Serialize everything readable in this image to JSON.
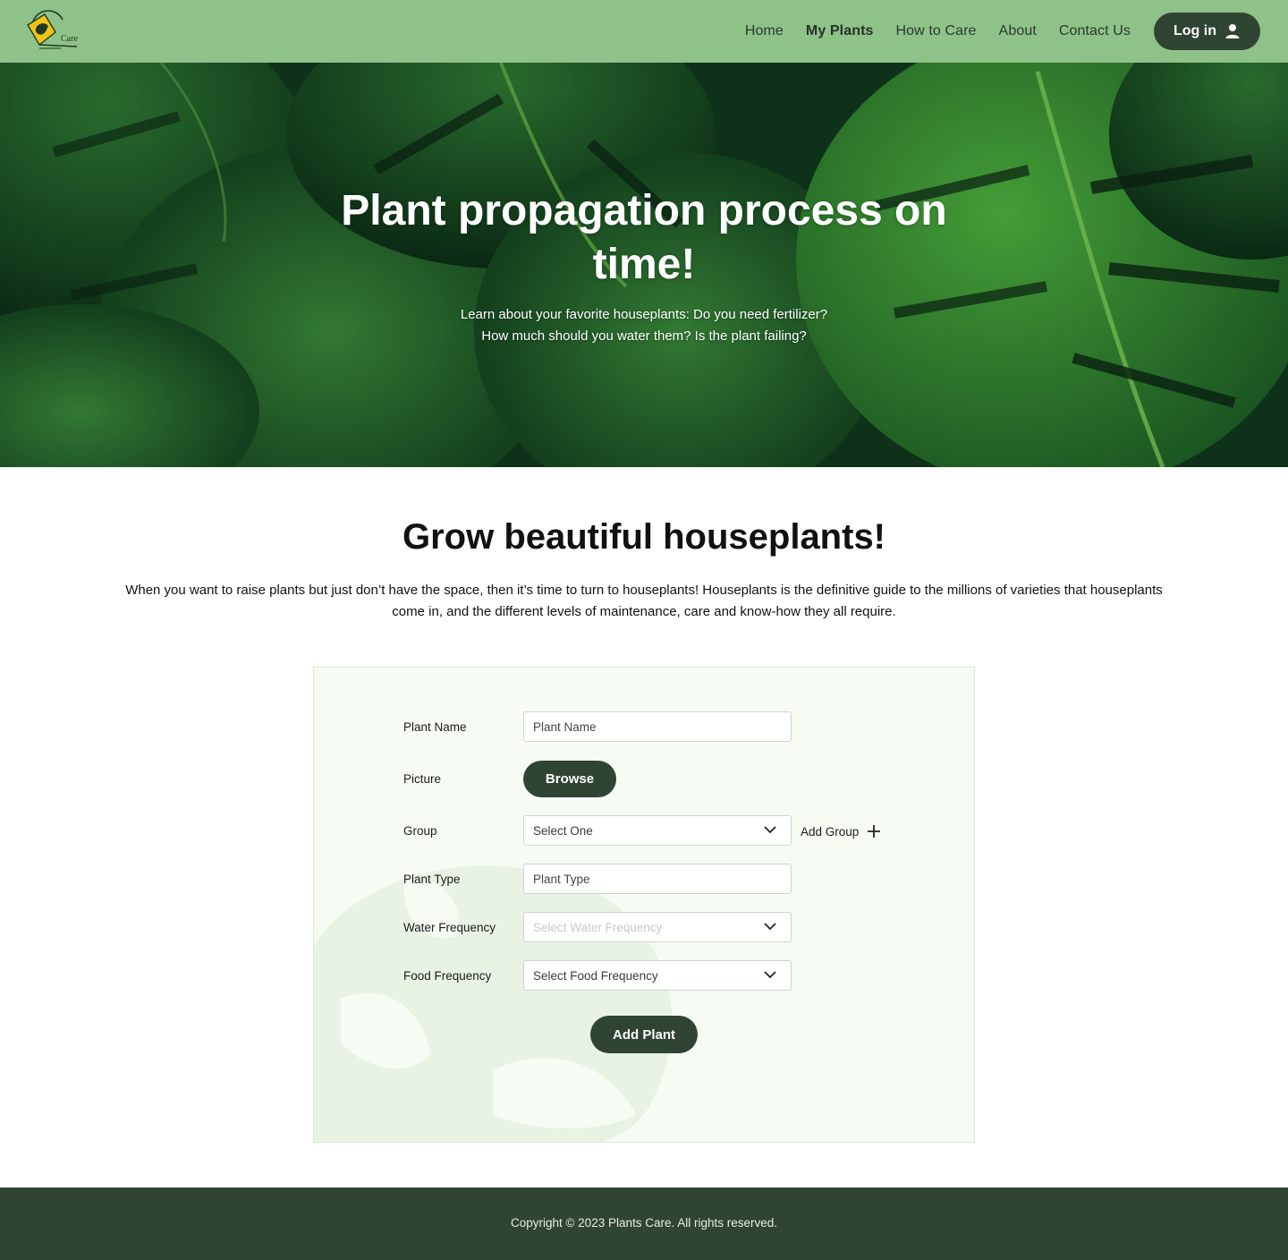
{
  "header": {
    "logo_text": "Care",
    "nav": [
      {
        "label": "Home",
        "active": false
      },
      {
        "label": "My Plants",
        "active": true
      },
      {
        "label": "How to Care",
        "active": false
      },
      {
        "label": "About",
        "active": false
      },
      {
        "label": "Contact Us",
        "active": false
      }
    ],
    "login_label": "Log in",
    "login_icon": "user-icon"
  },
  "hero": {
    "title": "Plant propagation process on time!",
    "subtitle_line1": "Learn about your favorite houseplants: Do you need fertilizer?",
    "subtitle_line2": "How much should you water them? Is the plant failing?"
  },
  "intro": {
    "title": "Grow beautiful houseplants!",
    "text": "When you want to raise plants but just don’t have the space, then it’s time to turn to houseplants! Houseplants is the definitive guide to the millions of varieties that houseplants come in, and the different levels of maintenance, care and know-how they all require."
  },
  "form": {
    "plant_name": {
      "label": "Plant Name",
      "placeholder": "Plant Name"
    },
    "picture": {
      "label": "Picture",
      "button": "Browse"
    },
    "group": {
      "label": "Group",
      "value": "Select One",
      "add_label": "Add Group"
    },
    "plant_type": {
      "label": "Plant Type",
      "placeholder": "Plant Type"
    },
    "water_frequency": {
      "label": "Water Frequency",
      "value": "Select Water Frequency"
    },
    "food_frequency": {
      "label": "Food Frequency",
      "value": "Select Food Frequency"
    },
    "submit_label": "Add Plant"
  },
  "footer": {
    "copyright": "Copyright © 2023 Plants Care. All rights reserved."
  },
  "colors": {
    "header_bg": "#8fc288",
    "primary_dark": "#2f4433",
    "form_bg": "#f6fcf4",
    "footer_bg": "#2f4433"
  }
}
